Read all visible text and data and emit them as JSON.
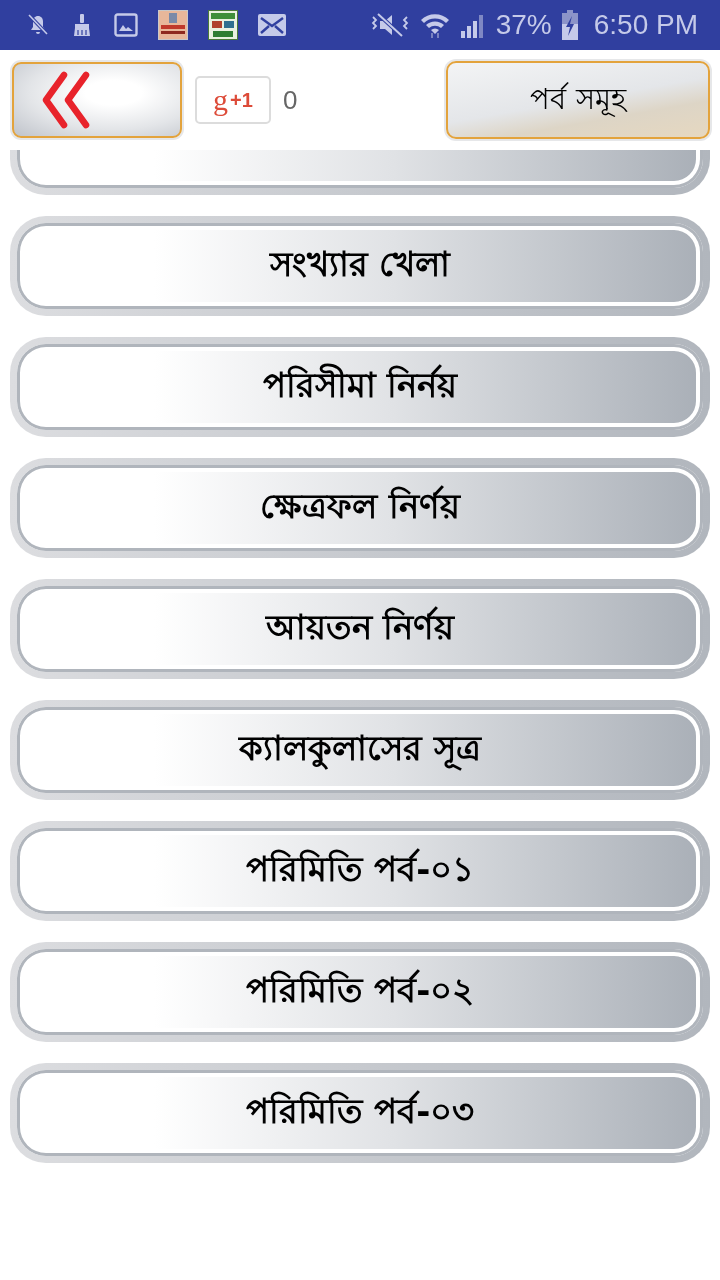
{
  "status_bar": {
    "battery": "37%",
    "time": "6:50 PM"
  },
  "header": {
    "plus_one": {
      "logo": "g",
      "label": "+1",
      "count": "0"
    },
    "episodes_button": "পর্ব সমূহ"
  },
  "items": [
    {
      "kind": "partial"
    },
    {
      "kind": "full",
      "label": "সংখ্যার খেলা"
    },
    {
      "kind": "full",
      "label": "পরিসীমা নির্নয়"
    },
    {
      "kind": "full",
      "label": "ক্ষেত্রফল নির্ণয়"
    },
    {
      "kind": "full",
      "label": "আয়তন নির্ণয়"
    },
    {
      "kind": "full",
      "label": "ক্যালকুলাসের সূত্র"
    },
    {
      "kind": "full",
      "label": "পরিমিতি পর্ব-০১"
    },
    {
      "kind": "full",
      "label": "পরিমিতি পর্ব-০২"
    },
    {
      "kind": "full",
      "label": "পরিমিতি পর্ব-০৩"
    }
  ]
}
